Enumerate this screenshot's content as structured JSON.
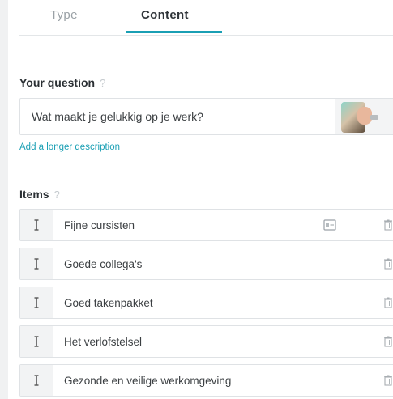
{
  "tabs": [
    {
      "label": "Type",
      "active": false
    },
    {
      "label": "Content",
      "active": true
    }
  ],
  "question": {
    "label": "Your question",
    "help": "?",
    "value": "Wat maakt je gelukkig op je werk?",
    "add_description_link": "Add a longer description"
  },
  "items": {
    "label": "Items",
    "help": "?",
    "list": [
      {
        "label": "Fijne cursisten"
      },
      {
        "label": "Goede collega's"
      },
      {
        "label": "Goed takenpakket"
      },
      {
        "label": "Het verlofstelsel"
      },
      {
        "label": "Gezonde en veilige werkomgeving"
      }
    ]
  },
  "colors": {
    "accent": "#1a9fb4",
    "muted": "#9aa1a6",
    "border": "#dfe2e5",
    "handle_bg": "#f2f3f4"
  },
  "icons": {
    "drag": "drag-vertical-icon",
    "description": "description-card-icon",
    "delete": "trash-icon",
    "help": "question-mark-icon"
  }
}
